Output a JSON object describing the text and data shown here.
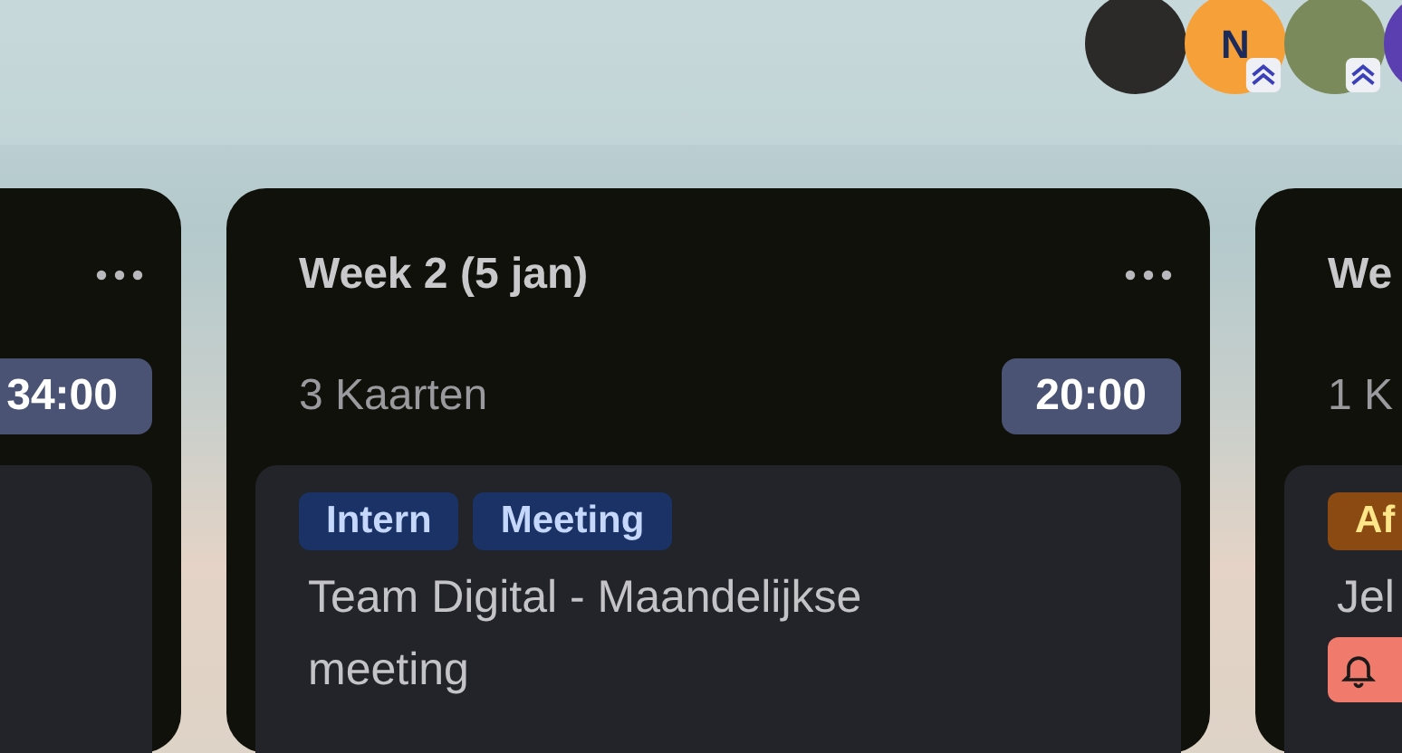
{
  "avatars": [
    {
      "kind": "photo",
      "badge": false,
      "color": "#2b2a28"
    },
    {
      "kind": "initial",
      "initial": "N",
      "badge": true,
      "color": "#f6a03a"
    },
    {
      "kind": "photo",
      "badge": true,
      "color": "#7a8a5a"
    },
    {
      "kind": "initial",
      "badge": false,
      "color": "#5b3fb0"
    }
  ],
  "columns": [
    {
      "total": "34:00",
      "cards": [
        {
          "kind": "blank"
        }
      ]
    },
    {
      "title": "Week 2 (5 jan)",
      "count": "3 Kaarten",
      "total": "20:00",
      "cards": [
        {
          "kind": "task",
          "tags": [
            {
              "label": "Intern",
              "color": "#1a3266"
            },
            {
              "label": "Meeting",
              "color": "#1a3266"
            }
          ],
          "title": "Team Digital - Maandelijkse meeting"
        }
      ]
    },
    {
      "title": "We",
      "count": "1 K",
      "cards": [
        {
          "kind": "task",
          "tags": [
            {
              "label": "Af",
              "color": "#8a4a12"
            }
          ],
          "title": "Jel",
          "reminder": true
        }
      ]
    }
  ]
}
